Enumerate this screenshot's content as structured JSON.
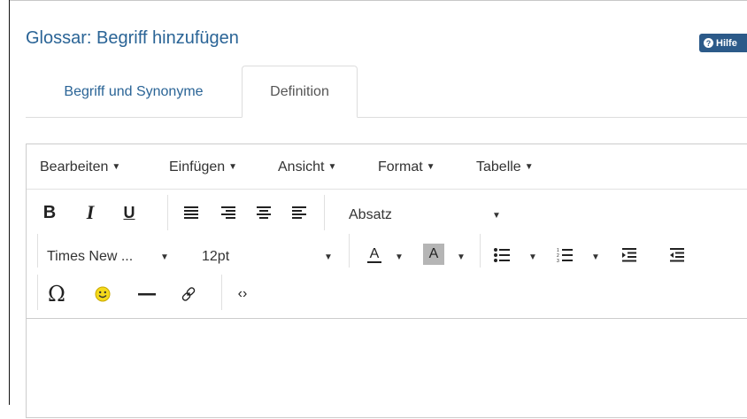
{
  "title": "Glossar: Begriff hinzufügen",
  "help_button": "Hilfe",
  "tabs": [
    {
      "label": "Begriff und Synonyme"
    },
    {
      "label": "Definition"
    }
  ],
  "menu": [
    {
      "label": "Bearbeiten"
    },
    {
      "label": "Einfügen"
    },
    {
      "label": "Ansicht"
    },
    {
      "label": "Format"
    },
    {
      "label": "Tabelle"
    }
  ],
  "toolbar": {
    "bold": "B",
    "italic": "I",
    "underline": "U",
    "block_format": "Absatz",
    "font_family": "Times New ...",
    "font_size": "12pt",
    "text_color_glyph": "A",
    "bg_color_glyph": "A",
    "special_char": "Ω",
    "source_code": "‹›"
  },
  "colors": {
    "accent": "#2a6496",
    "help_button_bg": "#2c5a89",
    "emoticon": "#f4d91b"
  },
  "icons": [
    "question-icon",
    "align-left-icon",
    "align-right-icon",
    "align-center-icon",
    "align-justify-icon",
    "bullet-list-icon",
    "numbered-list-icon",
    "outdent-icon",
    "indent-icon",
    "omega-icon",
    "emoticon-icon",
    "horizontal-rule-icon",
    "link-icon",
    "source-code-icon"
  ]
}
